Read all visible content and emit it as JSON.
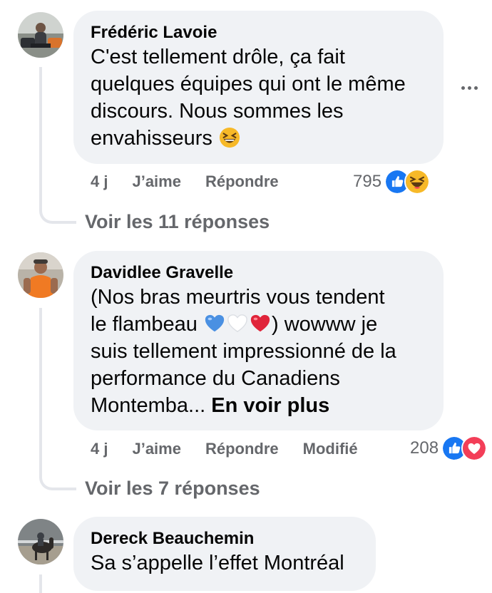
{
  "comments": [
    {
      "author": "Frédéric Lavoie",
      "text_lines": [
        "C'est tellement drôle, ça fait",
        "quelques équipes qui ont le même",
        "discours. Nous sommes les",
        "envahisseurs"
      ],
      "trailing_emoji": "grinning-squinting-face",
      "time": "4 j",
      "like_label": "J’aime",
      "reply_label": "Répondre",
      "reaction_count": "795",
      "reactions": [
        "like",
        "haha"
      ],
      "view_replies": "Voir les 11 réponses"
    },
    {
      "author": "Davidlee Gravelle",
      "text_line1": "(Nos bras meurtris vous tendent",
      "text_line2_pre": "le flambeau",
      "text_line2_post": ") wowww je",
      "hearts": [
        "blue-heart",
        "white-heart",
        "red-heart"
      ],
      "text_line3": "suis tellement impressionné de la",
      "text_line4": "performance du Canadiens",
      "text_line5": "Montemba...",
      "see_more": "En voir plus",
      "time": "4 j",
      "like_label": "J’aime",
      "reply_label": "Répondre",
      "edited_label": "Modifié",
      "reaction_count": "208",
      "reactions": [
        "like",
        "love"
      ],
      "view_replies": "Voir les 7 réponses"
    },
    {
      "author": "Dereck Beauchemin",
      "text": "Sa s’appelle l’effet Montréal"
    }
  ],
  "colors": {
    "bubble": "#f0f2f5",
    "secondary_text": "#65676b",
    "like_blue": "#1877f2",
    "love_red": "#f33e58",
    "haha_yellow": "#f7b928"
  }
}
